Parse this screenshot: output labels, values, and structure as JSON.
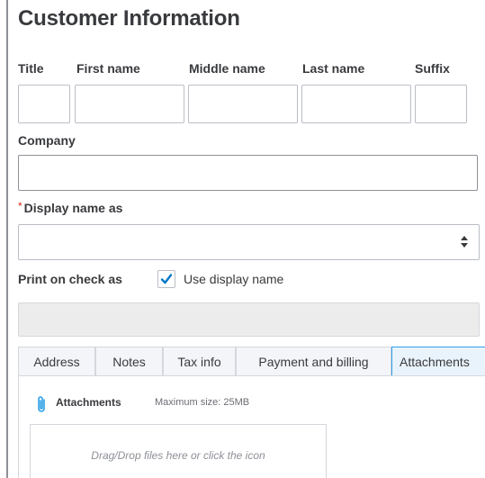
{
  "page_title": "Customer Information",
  "name_fields": {
    "title_label": "Title",
    "first_name_label": "First name",
    "middle_name_label": "Middle name",
    "last_name_label": "Last name",
    "suffix_label": "Suffix",
    "title_value": "",
    "first_name_value": "",
    "middle_name_value": "",
    "last_name_value": "",
    "suffix_value": ""
  },
  "company": {
    "label": "Company",
    "value": ""
  },
  "display_name": {
    "required_marker": "*",
    "label": "Display name as",
    "value": ""
  },
  "print_on_check": {
    "label": "Print on check as",
    "checkbox_checked": true,
    "checkbox_label": "Use display name",
    "value": ""
  },
  "tabs": [
    {
      "label": "Address",
      "active": false
    },
    {
      "label": "Notes",
      "active": false
    },
    {
      "label": "Tax info",
      "active": false
    },
    {
      "label": "Payment and billing",
      "active": false
    },
    {
      "label": "Attachments",
      "active": true
    }
  ],
  "attachments": {
    "heading": "Attachments",
    "max_size": "Maximum size: 25MB",
    "drop_hint": "Drag/Drop files here or click the icon"
  },
  "colors": {
    "text": "#393a3d",
    "required": "#d52b1e",
    "check_accent": "#0077c5",
    "active_tab_border": "#2ca0e8",
    "input_border": "#babec5"
  },
  "icons": {
    "checkbox": "check-icon",
    "select": "up-down-chevron-icon",
    "attach": "paperclip-icon"
  }
}
